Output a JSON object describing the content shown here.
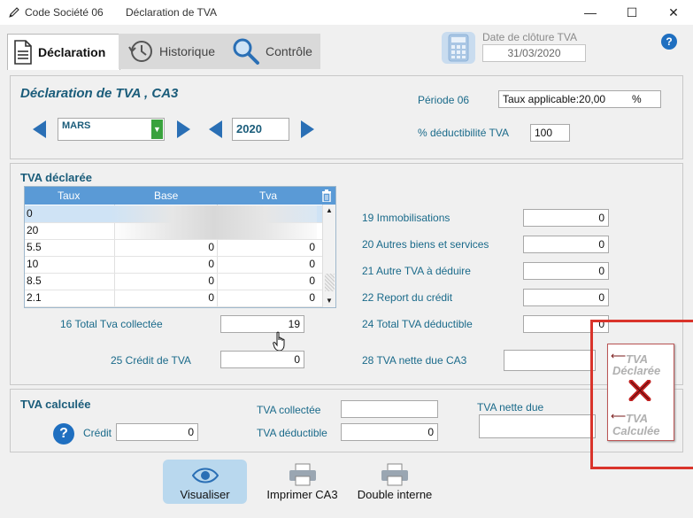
{
  "window": {
    "app_title": "Code Société 06",
    "doc_title": "Déclaration de TVA",
    "minimize": "—",
    "maximize": "☐",
    "close": "✕"
  },
  "tabs": [
    {
      "label": "Déclaration",
      "icon": "document-icon",
      "active": true
    },
    {
      "label": "Historique",
      "icon": "clock-history-icon",
      "active": false
    },
    {
      "label": "Contrôle",
      "icon": "magnifier-icon",
      "active": false
    }
  ],
  "closing": {
    "label": "Date de clôture TVA",
    "value": "31/03/2020",
    "icon": "calculator-icon"
  },
  "help_icon": "?",
  "header": {
    "title": "Déclaration de TVA , CA3",
    "month": "MARS",
    "year": "2020",
    "period_label": "Période 06",
    "rate_value": "Taux applicable:20,00",
    "rate_unit": "%",
    "deduct_label": "% déductibilité TVA",
    "deduct_value": "100"
  },
  "declared": {
    "title": "TVA déclarée",
    "columns": [
      "Taux",
      "Base",
      "Tva"
    ],
    "rows": [
      {
        "taux": "0",
        "base": "",
        "tva": ""
      },
      {
        "taux": "20",
        "base": "",
        "tva": ""
      },
      {
        "taux": "5.5",
        "base": "0",
        "tva": "0"
      },
      {
        "taux": "10",
        "base": "0",
        "tva": "0"
      },
      {
        "taux": "8.5",
        "base": "0",
        "tva": "0"
      },
      {
        "taux": "2.1",
        "base": "0",
        "tva": "0"
      }
    ],
    "total_collected_label": "16 Total Tva collectée",
    "total_collected_value": "19",
    "credit_label": "25 Crédit de TVA",
    "credit_value": "0",
    "fields": [
      {
        "label": "19  Immobilisations",
        "value": "0"
      },
      {
        "label": "20 Autres biens et services",
        "value": "0"
      },
      {
        "label": "21 Autre TVA à déduire",
        "value": "0"
      },
      {
        "label": "22 Report du crédit",
        "value": "0"
      },
      {
        "label": "24 Total TVA déductible",
        "value": "0"
      },
      {
        "label": "28 TVA nette due CA3",
        "value": ""
      }
    ]
  },
  "calculated": {
    "title": "TVA calculée",
    "credit_label": "Crédit",
    "credit_value": "0",
    "collected_label": "TVA collectée",
    "collected_value": "",
    "deductible_label": "TVA déductible",
    "deductible_value": "0",
    "net_due_label": "TVA nette due",
    "net_due_value": ""
  },
  "transfer_button": {
    "line1": "TVA",
    "line2": "Déclarée",
    "line3": "TVA",
    "line4": "Calculée"
  },
  "actions": [
    {
      "label": "Visualiser",
      "icon": "eye-icon"
    },
    {
      "label": "Imprimer CA3",
      "icon": "printer-icon"
    },
    {
      "label": "Double interne",
      "icon": "printer-icon"
    }
  ],
  "colors": {
    "accent": "#2a6fb5",
    "heading": "#1a5c7a",
    "table_header": "#5a9ad6",
    "highlight": "#d9342b"
  }
}
